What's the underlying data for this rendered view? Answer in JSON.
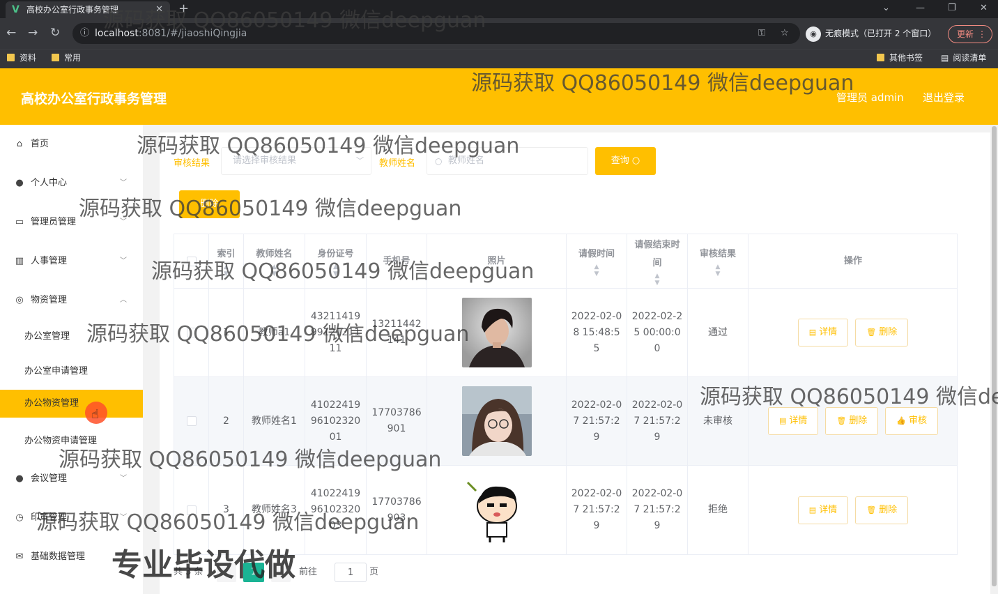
{
  "browser": {
    "tab_title": "高校办公室行政事务管理",
    "tab_favicon": "V",
    "url_host": "localhost",
    "url_path": ":8081/#/jiaoshiQingjia",
    "incognito_label": "无痕模式（已打开 2 个窗口）",
    "update_label": "更新",
    "bookmarks": [
      "资料",
      "常用"
    ],
    "bookmarks_right": [
      "其他书签",
      "阅读清单"
    ]
  },
  "header": {
    "title": "高校办公室行政事务管理",
    "user_label": "管理员 admin",
    "logout_label": "退出登录"
  },
  "sidebar": {
    "items": [
      {
        "label": "首页",
        "icon": "home-icon"
      },
      {
        "label": "个人中心",
        "icon": "user-icon"
      },
      {
        "label": "管理员管理",
        "icon": "id-card-icon"
      },
      {
        "label": "人事管理",
        "icon": "chart-icon"
      },
      {
        "label": "物资管理",
        "icon": "compass-icon"
      },
      {
        "label": "会议管理",
        "icon": "bulb-icon"
      },
      {
        "label": "印章管理",
        "icon": "stamp-icon"
      },
      {
        "label": "基础数据管理",
        "icon": "mail-icon"
      }
    ],
    "subitems": [
      "办公室管理",
      "办公室申请管理",
      "办公物资管理",
      "办公物资申请管理"
    ],
    "active_subitem": "办公物资管理"
  },
  "filters": {
    "audit_label": "审核结果",
    "audit_placeholder": "请选择审核结果",
    "name_label": "教师姓名",
    "name_placeholder": "教师姓名",
    "search_label": "查询",
    "batch_delete_label": "删除"
  },
  "table": {
    "columns": [
      "",
      "索引",
      "教师姓名",
      "身份证号",
      "手机号",
      "照片",
      "请假时间",
      "请假结束时间",
      "审核结果",
      "操作"
    ],
    "rows": [
      {
        "index": "1",
        "name": "教师a1",
        "id_card": "432114199912121111",
        "phone": "13211442141",
        "photo": "young man in dark coat",
        "start": "2022-02-08 15:48:55",
        "end": "2022-02-25 00:00:00",
        "result": "通过",
        "actions": [
          "详情",
          "删除"
        ]
      },
      {
        "index": "2",
        "name": "教师姓名1",
        "id_card": "410224199610232001",
        "phone": "17703786901",
        "photo": "girl with glasses",
        "start": "2022-02-07 21:57:29",
        "end": "2022-02-07 21:57:29",
        "result": "未审核",
        "actions": [
          "详情",
          "删除",
          "审核"
        ]
      },
      {
        "index": "3",
        "name": "教师姓名3",
        "id_card": "410224199610232003",
        "phone": "17703786903",
        "photo": "cartoon boy",
        "start": "2022-02-07 21:57:29",
        "end": "2022-02-07 21:57:29",
        "result": "拒绝",
        "actions": [
          "详情",
          "删除"
        ]
      }
    ]
  },
  "pagination": {
    "total": "共 3 条",
    "current_page": "1",
    "goto_label": "前往",
    "goto_value": "1",
    "page_unit": "页"
  },
  "watermarks": {
    "text": "源码获取 QQ86050149 微信deepguan",
    "big": "专业毕设代做"
  },
  "colors": {
    "accent": "#ffbf00",
    "page_active": "#1ab394"
  }
}
